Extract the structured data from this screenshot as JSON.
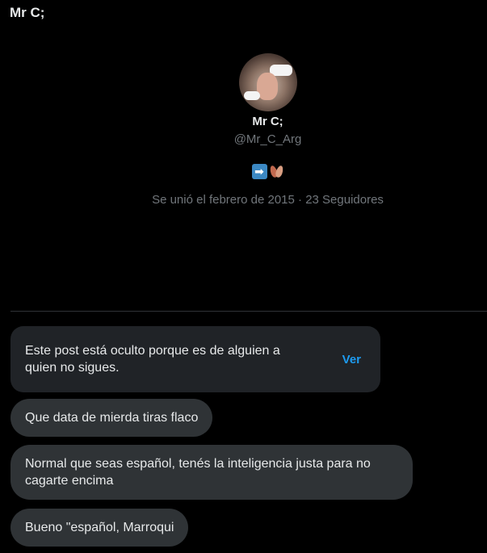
{
  "header": {
    "title": "Mr C;"
  },
  "profile": {
    "name": "Mr C;",
    "handle": "@Mr_C_Arg",
    "bio_icons": [
      "right-arrow-icon",
      "fallen-leaf-icon"
    ],
    "bio_arrow_glyph": "➡",
    "joined": "Se unió el febrero de 2015 · 23 Seguidores"
  },
  "messages": {
    "hidden_notice": "Este post está oculto porque es de alguien a quien no sigues.",
    "hidden_action": "Ver",
    "items": [
      "Que data de mierda tiras flaco",
      "Normal que seas español, tenés la inteligencia justa para no cagarte encima",
      "Bueno \"español, Marroqui"
    ]
  },
  "colors": {
    "background": "#000000",
    "bubble": "#2f3336",
    "accent": "#1d9bf0",
    "muted": "#71767b"
  }
}
